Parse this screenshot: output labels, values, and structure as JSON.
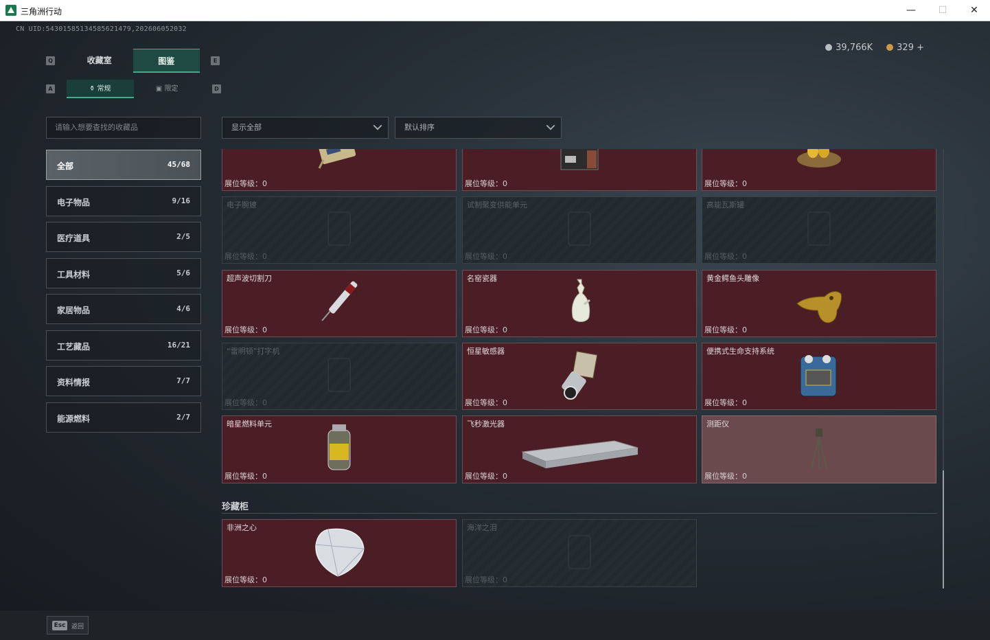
{
  "window": {
    "title": "三角洲行动",
    "controls": [
      "—",
      "☐",
      "✕"
    ]
  },
  "header": {
    "uid": "CN UID:54301585134585621479,202606052032",
    "currency": [
      {
        "value": "39,766K",
        "color": "#b8bfc4"
      },
      {
        "value": "329 +",
        "color": "#c89a4a"
      }
    ]
  },
  "keyhints": {
    "q": "Q",
    "e": "E",
    "a": "A",
    "d": "D"
  },
  "tabs": [
    {
      "label": "收藏室"
    },
    {
      "label": "图鉴"
    }
  ],
  "subtabs": [
    {
      "label": "常规"
    },
    {
      "label": "限定"
    }
  ],
  "search": {
    "placeholder": "请输入想要查找的收藏品"
  },
  "filters": {
    "show": "显示全部",
    "sort": "默认排序"
  },
  "categories": [
    {
      "name": "全部",
      "count": "45/68"
    },
    {
      "name": "电子物品",
      "count": "9/16"
    },
    {
      "name": "医疗道具",
      "count": "2/5"
    },
    {
      "name": "工具材料",
      "count": "5/6"
    },
    {
      "name": "家居物品",
      "count": "4/6"
    },
    {
      "name": "工艺藏品",
      "count": "16/21"
    },
    {
      "name": "资料情报",
      "count": "7/7"
    },
    {
      "name": "能源燃料",
      "count": "2/7"
    }
  ],
  "level_label": "展位等级：",
  "level_value": "0",
  "items": [
    {
      "name": "",
      "level": "0",
      "locked": false,
      "icon": "circuit-device"
    },
    {
      "name": "",
      "level": "0",
      "locked": false,
      "icon": "tape-recorder"
    },
    {
      "name": "",
      "level": "0",
      "locked": false,
      "icon": "golden-egg-nest"
    },
    {
      "name": "电子腕镣",
      "level": "0",
      "locked": true,
      "icon": "placeholder"
    },
    {
      "name": "试制聚变供能单元",
      "level": "0",
      "locked": true,
      "icon": "placeholder"
    },
    {
      "name": "高能瓦斯罐",
      "level": "0",
      "locked": true,
      "icon": "placeholder"
    },
    {
      "name": "超声波切割刀",
      "level": "0",
      "locked": false,
      "icon": "cutter"
    },
    {
      "name": "名窑瓷器",
      "level": "0",
      "locked": false,
      "icon": "porcelain-vase"
    },
    {
      "name": "黄金鳄鱼头雕像",
      "level": "0",
      "locked": false,
      "icon": "gold-crocodile"
    },
    {
      "name": "“雷明顿”打字机",
      "level": "0",
      "locked": true,
      "icon": "placeholder"
    },
    {
      "name": "恒星敏感器",
      "level": "0",
      "locked": false,
      "icon": "star-sensor"
    },
    {
      "name": "便携式生命支持系统",
      "level": "0",
      "locked": false,
      "icon": "life-support"
    },
    {
      "name": "暗星燃料单元",
      "level": "0",
      "locked": false,
      "icon": "fuel-canister"
    },
    {
      "name": "飞秒激光器",
      "level": "0",
      "locked": false,
      "icon": "laser-box"
    },
    {
      "name": "测距仪",
      "level": "0",
      "locked": false,
      "icon": "tripod"
    }
  ],
  "section": {
    "title": "珍藏柜"
  },
  "treasures": [
    {
      "name": "非洲之心",
      "level": "0",
      "locked": false,
      "icon": "diamond"
    },
    {
      "name": "海洋之泪",
      "level": "0",
      "locked": true,
      "icon": "placeholder"
    }
  ],
  "footer": {
    "esc_key": "Esc",
    "esc_label": "返回"
  }
}
